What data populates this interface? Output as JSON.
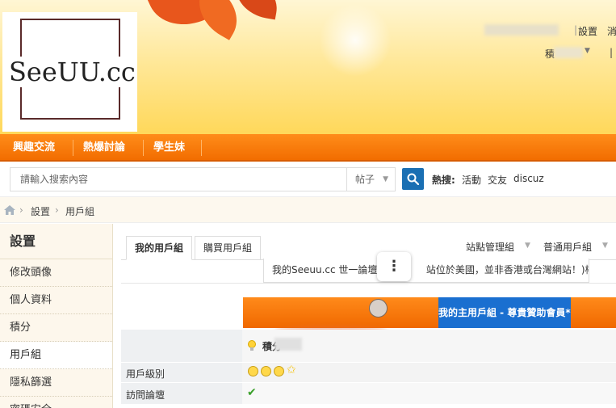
{
  "header": {
    "logo_text": "SeeUU.cc",
    "settings_link": "設置",
    "message_link_partial": "消",
    "credit_label_partial": "積",
    "edge_glyph": "|"
  },
  "nav": {
    "items": [
      {
        "label": "興趣交流"
      },
      {
        "label": "熱爆討論"
      },
      {
        "label": "學生妹"
      }
    ]
  },
  "search": {
    "placeholder": "請輸入搜索內容",
    "type_selected": "帖子",
    "hot_label": "熱搜:",
    "hot_links": [
      "活動",
      "交友",
      "discuz"
    ]
  },
  "breadcrumb": {
    "items": [
      "設置",
      "用戶組"
    ],
    "separator": "›"
  },
  "sidebar": {
    "title": "設置",
    "items": [
      {
        "label": "修改頭像"
      },
      {
        "label": "個人資料"
      },
      {
        "label": "積分"
      },
      {
        "label": "用戶組"
      },
      {
        "label": "隱私篩選"
      },
      {
        "label": "密碼安全"
      }
    ]
  },
  "main": {
    "tabs": [
      {
        "label": "我的用戶組"
      },
      {
        "label": "購買用戶組"
      }
    ],
    "right_links": [
      "站點管理組",
      "普通用戶組"
    ],
    "notice_prefix": "我的Seeuu.cc 世一論壇 (",
    "notice_suffix": "站位於美國，並非香港或台灣網站！)權限",
    "kebab": "⋮",
    "group_header": "我的主用戶組 - 尊貴贊助會員*",
    "credit_label": "積分",
    "rows": [
      {
        "label": "用戶級別"
      },
      {
        "label": "訪問論壇"
      }
    ],
    "check_glyph": "✔",
    "star_glyph": "✩"
  },
  "colors": {
    "nav_orange": "#f26d00",
    "search_blue": "#1a6fb3",
    "group_blue": "#1a6fd0",
    "sidebar_bg": "#fdf7ec"
  }
}
